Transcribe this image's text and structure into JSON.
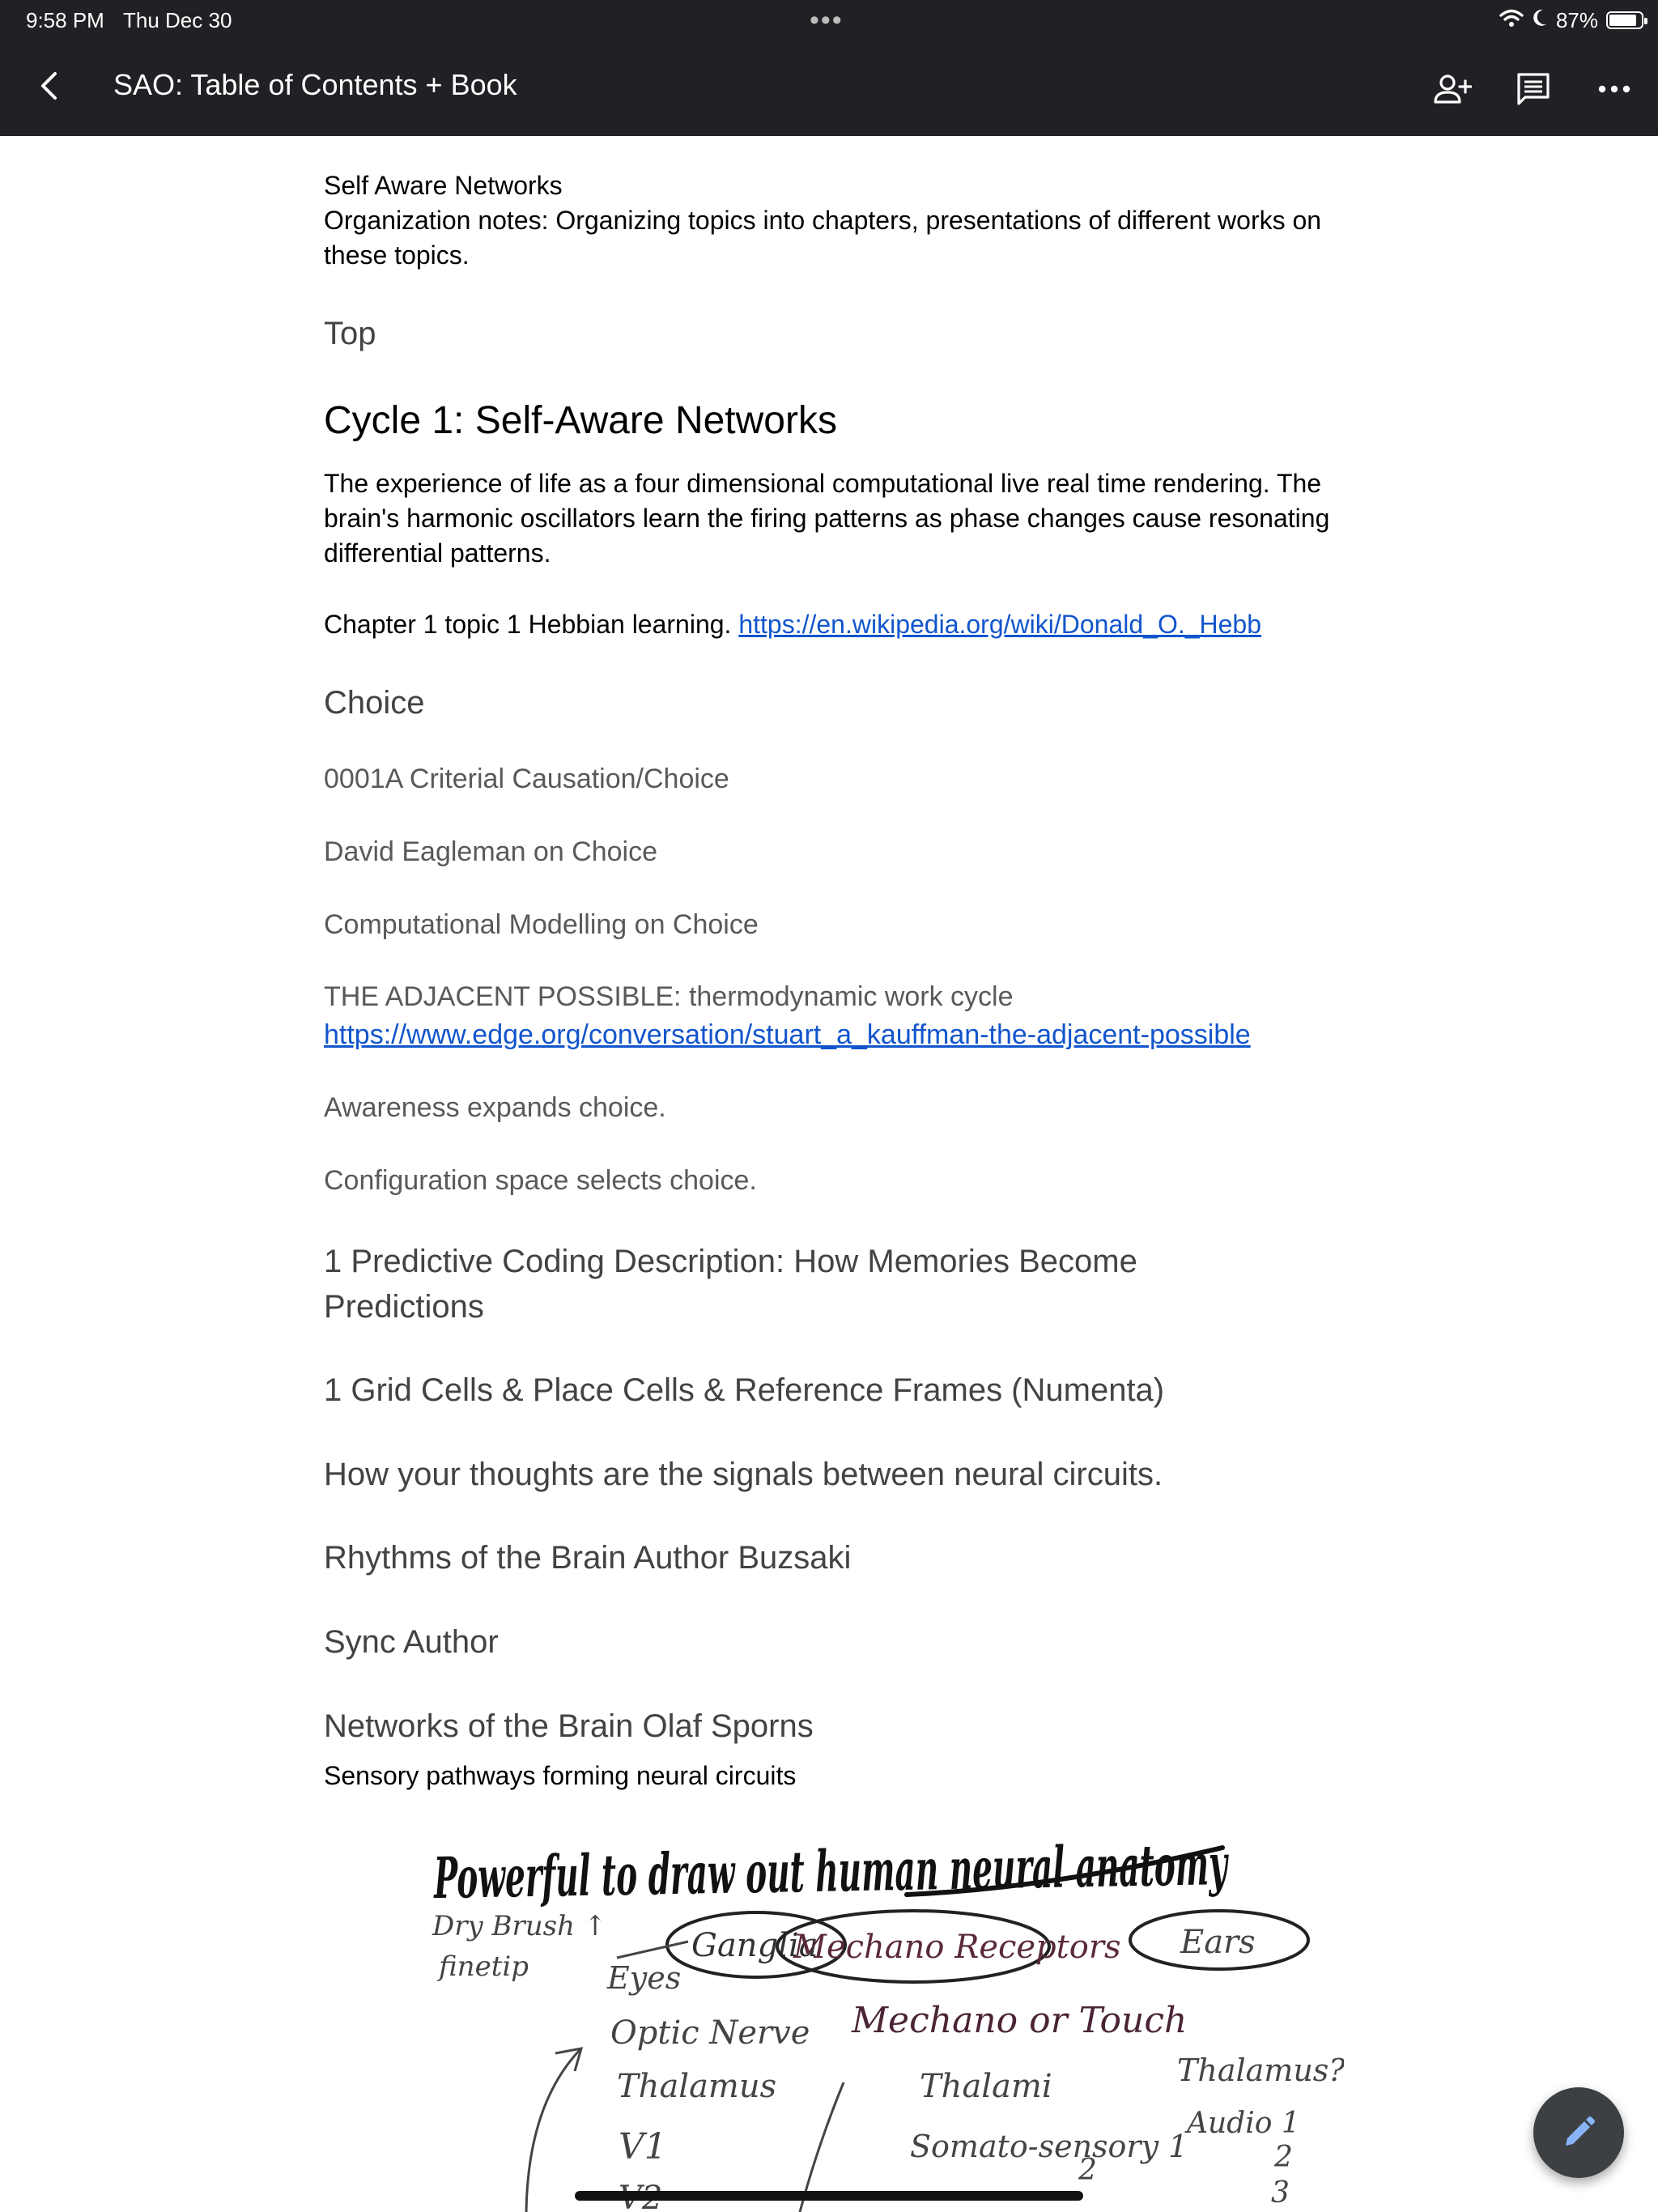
{
  "status_bar": {
    "time": "9:58 PM",
    "date": "Thu Dec 30",
    "multitask_dots": "•••",
    "battery_percent": "87%",
    "battery_level": 0.87
  },
  "app_bar": {
    "title": "SAO: Table of Contents + Book",
    "icons": [
      "back-chevron-icon",
      "add-person-icon",
      "comment-icon",
      "more-horizontal-icon"
    ],
    "bg_color": "#202124"
  },
  "document": {
    "heading_title": "Self Aware Networks",
    "org_notes": "Organization notes: Organizing topics into chapters, presentations of different works on these topics.",
    "top_label": "Top",
    "cycle_heading": "Cycle 1: Self-Aware Networks",
    "cycle_intro": "The experience of life as a four dimensional computational live real time rendering. The brain's harmonic oscillators learn the firing patterns as phase changes cause resonating differential patterns.",
    "chapter_text": "Chapter 1 topic 1 Hebbian learning.",
    "chapter_link": "https://en.wikipedia.org/wiki/Donald_O._Hebb",
    "choice_heading": "Choice",
    "choice_items": [
      "0001A Criterial Causation/Choice",
      "David Eagleman on Choice",
      "Computational Modelling on Choice"
    ],
    "adjacent_text": "THE ADJACENT POSSIBLE: thermodynamic work cycle",
    "adjacent_link": "https://www.edge.org/conversation/stuart_a_kauffman-the-adjacent-possible",
    "awareness": "Awareness expands choice.",
    "configuration": "Configuration space selects choice.",
    "predictive": "1 Predictive Coding Description: How Memories Become Predictions",
    "grid_cells": "1 Grid Cells & Place Cells & Reference Frames (Numenta)",
    "thoughts": "How your thoughts are the signals between neural circuits.",
    "rhythms": "Rhythms of the Brain Author Buzsaki",
    "sync": "Sync Author",
    "networks": "Networks of the Brain Olaf Sporns",
    "sensory": "Sensory pathways forming neural circuits",
    "link_color": "#1155cc"
  },
  "drawing": {
    "headline": "Powerful to draw out human neural anatomy",
    "brush_note_1": "Dry Brush ↑",
    "brush_note_2": "finetip",
    "ganglia": "Ganglia",
    "eyes": "Eyes",
    "optic_nerve": "Optic Nerve",
    "thalamus_1": "Thalamus",
    "v1": "V1",
    "v2": "V2",
    "mechano_receptors": "Mechano Receptors",
    "mechano_touch": "Mechano or Touch",
    "thalami": "Thalami",
    "somatosensory": "Somato-sensory 1",
    "somato_2": "2",
    "ears": "Ears",
    "thalamus_q": "Thalamus?",
    "audio": "Audio 1",
    "audio_2": "2",
    "audio_3": "3"
  },
  "fab": {
    "icon": "edit-pencil-icon"
  }
}
